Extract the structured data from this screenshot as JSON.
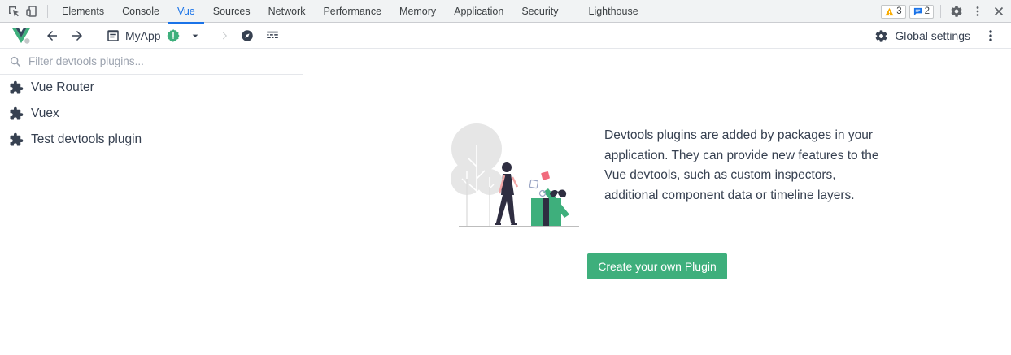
{
  "devtools": {
    "tabs": [
      {
        "label": "Elements"
      },
      {
        "label": "Console"
      },
      {
        "label": "Vue",
        "active": true
      },
      {
        "label": "Sources"
      },
      {
        "label": "Network"
      },
      {
        "label": "Performance"
      },
      {
        "label": "Memory"
      },
      {
        "label": "Application"
      },
      {
        "label": "Security"
      },
      {
        "label": "Lighthouse"
      }
    ],
    "warnings_count": "3",
    "messages_count": "2",
    "icons": [
      "inspect-element-icon",
      "device-toolbar-icon",
      "warning-icon",
      "message-icon",
      "gear-icon",
      "more-vertical-icon",
      "close-icon"
    ],
    "accent_color": "#1a73e8"
  },
  "toolbar": {
    "app_name": "MyApp",
    "global_settings_label": "Global settings",
    "icons": [
      "vue-logo-icon",
      "arrow-left-icon",
      "arrow-right-icon",
      "app-window-icon",
      "bug-badge-icon",
      "dropdown-caret-icon",
      "chevron-right-icon",
      "compass-icon",
      "timeline-icon",
      "gear-icon",
      "more-vertical-icon"
    ]
  },
  "sidebar": {
    "filter_placeholder": "Filter devtools plugins...",
    "plugins": [
      {
        "label": "Vue Router"
      },
      {
        "label": "Vuex"
      },
      {
        "label": "Test devtools plugin"
      }
    ]
  },
  "main": {
    "description": "Devtools plugins are added by packages in your application. They can provide new features to the Vue devtools, such as custom inspectors, additional component data or timeline layers.",
    "create_button_label": "Create your own Plugin",
    "brand_color": "#3eaf7c"
  }
}
